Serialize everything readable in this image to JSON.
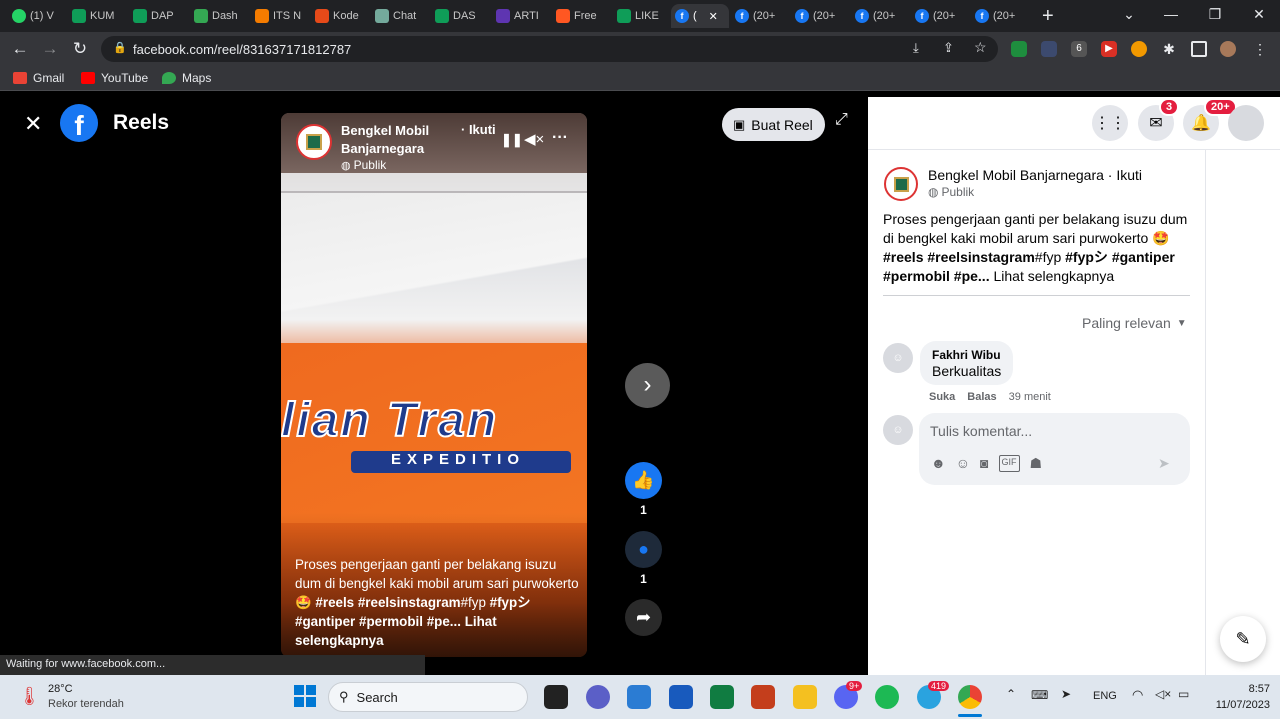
{
  "browser": {
    "tabs": [
      {
        "label": "(1) V",
        "icon": "whatsapp-icon",
        "color": "#25d366"
      },
      {
        "label": "KUM",
        "icon": "sheets-icon",
        "color": "#0f9d58"
      },
      {
        "label": "DAP",
        "icon": "sheets-icon",
        "color": "#0f9d58"
      },
      {
        "label": "Dash",
        "icon": "dashboard-icon",
        "color": "#34a853"
      },
      {
        "label": "ITS N",
        "icon": "its-icon",
        "color": "#f57c00"
      },
      {
        "label": "Kode",
        "icon": "kode-icon",
        "color": "#e64a19"
      },
      {
        "label": "Chat",
        "icon": "chatgpt-icon",
        "color": "#74aa9c"
      },
      {
        "label": "DAS",
        "icon": "sheets-icon",
        "color": "#0f9d58"
      },
      {
        "label": "ARTI",
        "icon": "arti-icon",
        "color": "#5e35b1"
      },
      {
        "label": "Free",
        "icon": "free-icon",
        "color": "#ff5722"
      },
      {
        "label": "LIKE",
        "icon": "sheets-icon",
        "color": "#0f9d58"
      },
      {
        "label": "(",
        "icon": "facebook-icon",
        "color": "#1877f2"
      },
      {
        "label": "(20+",
        "icon": "facebook-icon",
        "color": "#1877f2"
      },
      {
        "label": "(20+",
        "icon": "facebook-icon",
        "color": "#1877f2"
      },
      {
        "label": "(20+",
        "icon": "facebook-icon",
        "color": "#1877f2"
      },
      {
        "label": "(20+",
        "icon": "facebook-icon",
        "color": "#1877f2"
      },
      {
        "label": "(20+",
        "icon": "facebook-icon",
        "color": "#1877f2"
      }
    ],
    "new_tab": "+",
    "url": "facebook.com/reel/831637171812787",
    "bookmarks": [
      {
        "label": "Gmail",
        "icon": "gmail-icon",
        "color": "#ea4335"
      },
      {
        "label": "YouTube",
        "icon": "youtube-icon",
        "color": "#ff0000"
      },
      {
        "label": "Maps",
        "icon": "maps-icon",
        "color": "#34a853"
      }
    ],
    "status": "Waiting for www.facebook.com..."
  },
  "reels": {
    "title": "Reels",
    "create_button": "Buat Reel",
    "page_name": "Bengkel Mobil Banjarnegara",
    "follow": "· Ikuti",
    "privacy": "Publik",
    "caption_plain": "Proses pengerjaan ganti per belakang isuzu dum di bengkel kaki mobil arum sari purwokerto 🤩 ",
    "caption_tags": "#reels #reelsinstagram",
    "caption_fyp": "#fyp",
    "caption_more": "#fypシ #gantiper #permobil #pe...",
    "see_more": "Lihat selengkapnya",
    "like_count": "1",
    "comment_count": "1",
    "truck_text_big": "lian Tran",
    "truck_text_small": "EXPEDITIO"
  },
  "post": {
    "author": "Bengkel Mobil Banjarnegara · Ikuti",
    "privacy": "Publik",
    "text_plain": "Proses pengerjaan ganti per belakang isuzu dum di bengkel kaki mobil arum sari purwokerto 🤩",
    "tag1": "#reels",
    "tag2": "#reelsinstagram",
    "tag3": "#fyp",
    "tag4": "#fypシ",
    "tag5": "#gantiper",
    "tag6": "#permobil",
    "tag7": "#pe...",
    "see_more": "Lihat selengkapnya",
    "sort": "Paling relevan",
    "comment": {
      "author": "Fakhri Wibu",
      "text": "Berkualitas",
      "like": "Suka",
      "reply": "Balas",
      "time": "39 menit"
    },
    "comment_placeholder": "Tulis komentar...",
    "messenger_badge": "3",
    "notif_badge": "20+"
  },
  "taskbar": {
    "weather_temp": "28°C",
    "weather_desc": "Rekor terendah",
    "search": "Search",
    "lang": "ENG",
    "time": "8:57",
    "date": "11/07/2023",
    "discord_badge": "9+",
    "telegram_badge": "419"
  }
}
